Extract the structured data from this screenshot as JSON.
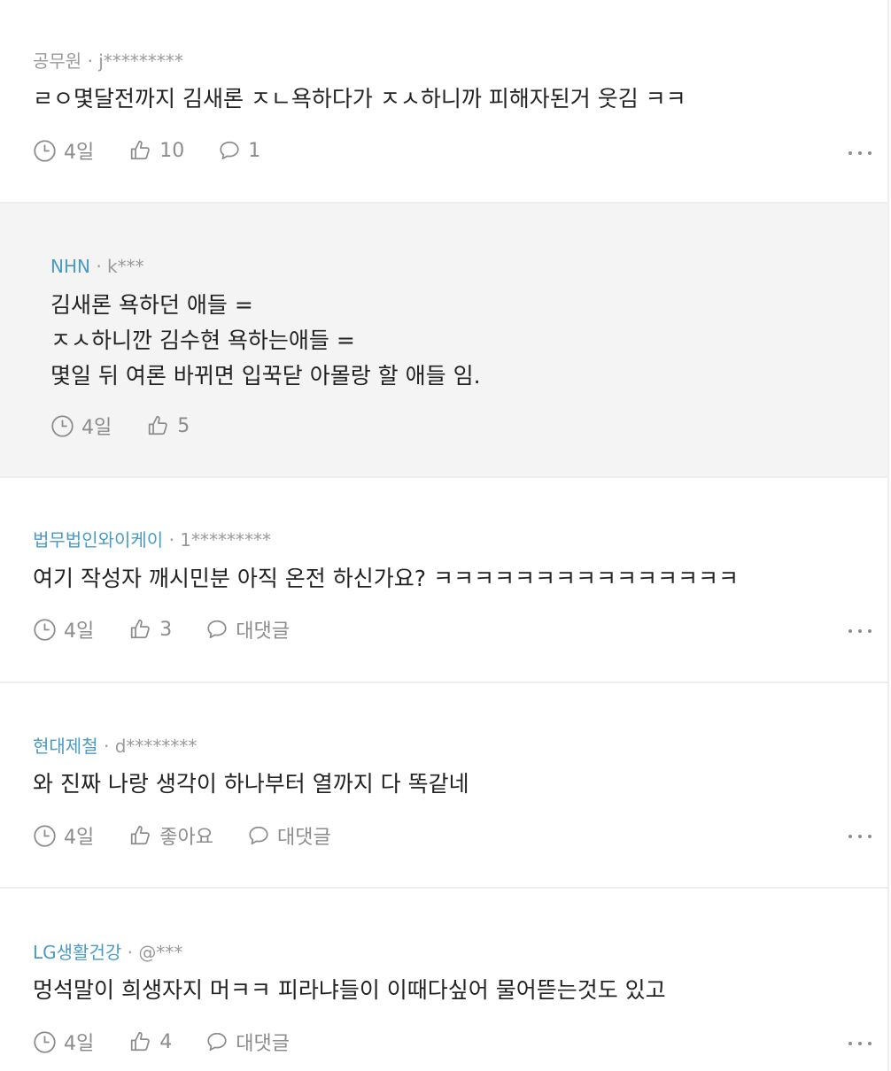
{
  "comments": [
    {
      "company": "공무원",
      "sep": "·",
      "user": "j*********",
      "text": "ㄹㅇ몇달전까지 김새론 ㅈㄴ욕하다가 ㅈㅅ하니까 피해자된거 웃김 ㅋㅋ",
      "time": "4일",
      "likes": "10",
      "replies": "1"
    },
    {
      "company": "NHN",
      "sep": "·",
      "user": "k***",
      "text": "김새론 욕하던 애들 =\nㅈㅅ하니깐 김수현 욕하는애들 =\n몇일 뒤 여론 바뀌면 입꾹닫 아몰랑 할 애들 임.",
      "time": "4일",
      "likes": "5"
    },
    {
      "company": "법무법인와이케이",
      "sep": "·",
      "user": "1*********",
      "text": "여기 작성자 깨시민분 아직 온전 하신가요? ㅋㅋㅋㅋㅋㅋㅋㅋㅋㅋㅋㅋㅋㅋㅋ",
      "time": "4일",
      "likes": "3",
      "replies": "대댓글"
    },
    {
      "company": "현대제철",
      "sep": "·",
      "user": "d********",
      "text": "와 진짜 나랑 생각이 하나부터 열까지 다 똑같네",
      "time": "4일",
      "likes": "좋아요",
      "replies": "대댓글"
    },
    {
      "company": "LG생활건강",
      "sep": "·",
      "user": "@***",
      "text": "멍석말이 희생자지 머ㅋㅋ 피라냐들이 이때다싶어 물어뜯는것도 있고",
      "time": "4일",
      "likes": "4",
      "replies": "대댓글"
    }
  ],
  "icons": {
    "time": "clock-icon",
    "like": "thumbs-up-icon",
    "reply": "speech-bubble-icon",
    "more": "more-options-icon"
  },
  "colors": {
    "company_link": "#4a9bc4",
    "muted": "#8c8c8c",
    "reply_bg": "#f4f4f4",
    "divider": "#eeeeee"
  }
}
